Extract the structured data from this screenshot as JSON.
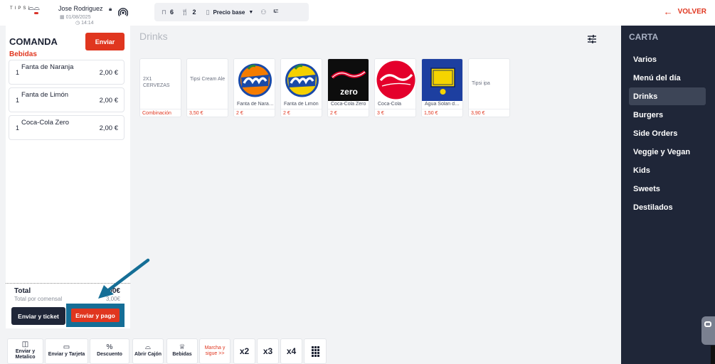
{
  "header": {
    "logo_text": "TIPSI",
    "user_name": "Jose Rodriguez",
    "date": "01/08/2025",
    "time": "14:14",
    "toolbar": {
      "tables_count": "6",
      "diners_count": "2",
      "price_label": "Precio base"
    },
    "back_label": "VOLVER"
  },
  "comanda": {
    "title": "COMANDA",
    "send_label": "Enviar",
    "section": "Bebidas",
    "items": [
      {
        "qty": "1",
        "name": "Fanta de Naranja",
        "price": "2,00 €"
      },
      {
        "qty": "1",
        "name": "Fanta de Limón",
        "price": "2,00 €"
      },
      {
        "qty": "1",
        "name": "Coca-Cola Zero",
        "price": "2,00 €"
      }
    ],
    "total_label": "Total",
    "total_value": "6,00€",
    "per_diner_label": "Total por comensal",
    "per_diner_value": "3,00€",
    "send_ticket_label": "Enviar y ticket",
    "send_pay_label": "Enviar y pago"
  },
  "main": {
    "category_title": "Drinks",
    "products": [
      {
        "tile_text": "2X1 CERVEZAS",
        "name": "",
        "price": "Combinación",
        "logo": "none"
      },
      {
        "tile_text": "Tipsi Cream Ale",
        "name": "",
        "price": "3,50 €",
        "logo": "none"
      },
      {
        "tile_text": "",
        "name": "Fanta de Naranja",
        "price": "2 €",
        "logo": "fanta-orange"
      },
      {
        "tile_text": "",
        "name": "Fanta de Limón",
        "price": "2 €",
        "logo": "fanta-lemon"
      },
      {
        "tile_text": "",
        "name": "Coca-Cola Zero",
        "price": "2 €",
        "logo": "coca-cola-zero"
      },
      {
        "tile_text": "",
        "name": "Coca-Cola",
        "price": "3 €",
        "logo": "coca-cola"
      },
      {
        "tile_text": "",
        "name": "Agua Solan de Cabras",
        "price": "1,50 €",
        "logo": "solan-de-cabras"
      },
      {
        "tile_text": "Tipsi ipa",
        "name": "",
        "price": "3,90 €",
        "logo": "none"
      }
    ]
  },
  "carta": {
    "title": "CARTA",
    "items": [
      "Varios",
      "Menú del día",
      "Drinks",
      "Burgers",
      "Side Orders",
      "Veggie y Vegan",
      "Kids",
      "Sweets",
      "Destilados"
    ],
    "active_index": 2
  },
  "bottom_bar": {
    "cash": "Enviar y Metalico",
    "card": "Enviar y Tarjeta",
    "discount": "Descuento",
    "drawer": "Abrir Cajón",
    "drinks": "Bebidas",
    "march": "Marcha y sigue >>",
    "x2": "x2",
    "x3": "x3",
    "x4": "x4"
  },
  "colors": {
    "accent_red": "#e0361f",
    "navy": "#1f2638",
    "annotation_blue": "#156e96"
  }
}
